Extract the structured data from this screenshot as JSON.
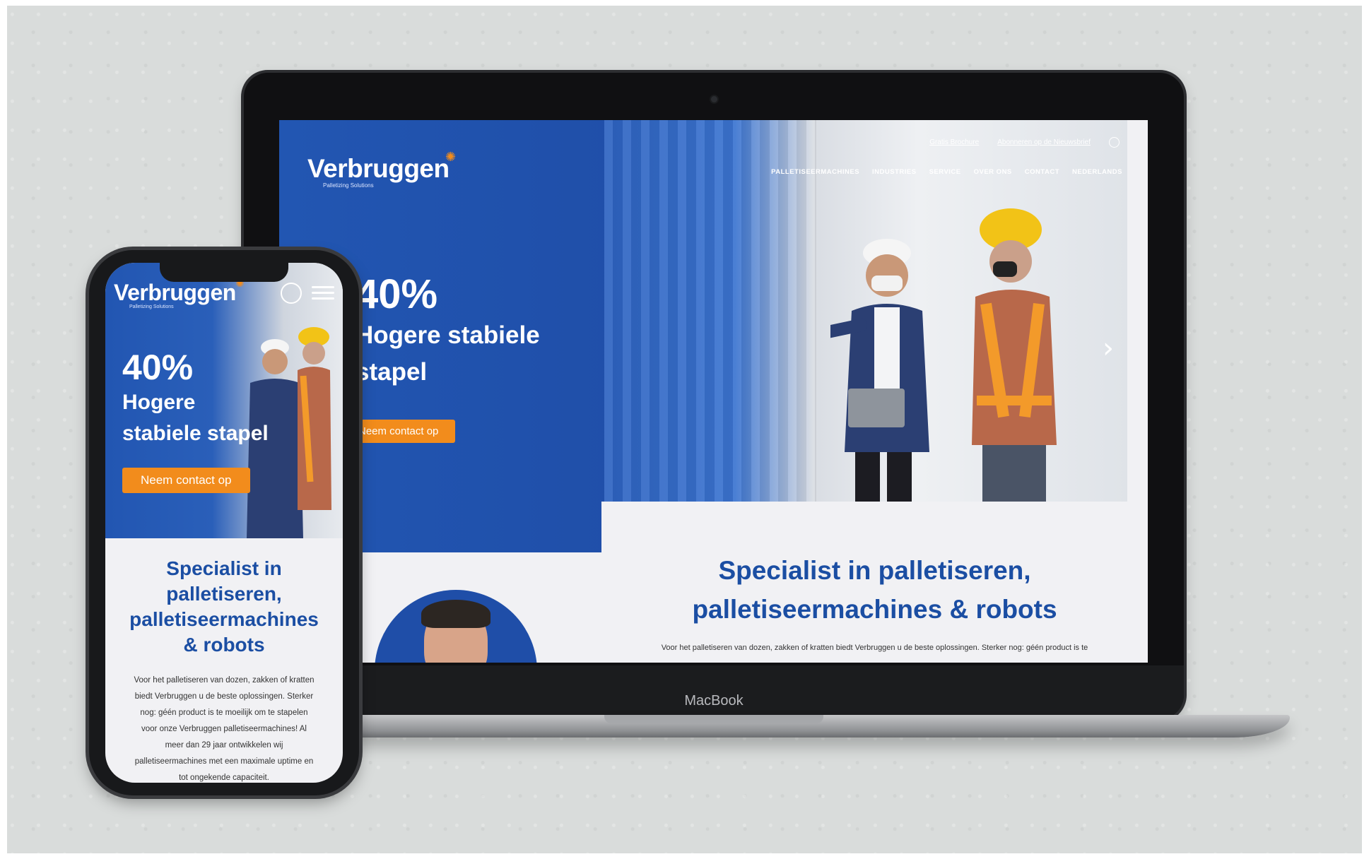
{
  "brand": {
    "name": "Verbruggen",
    "tagline": "Palletizing Solutions",
    "accent_color": "#f28c1c",
    "primary_color": "#1f4ea8"
  },
  "device_label": "MacBook",
  "desktop": {
    "top_links": [
      "Gratis Brochure",
      "Abonneren op de Nieuwsbrief"
    ],
    "nav": [
      "PALLETISEERMACHINES",
      "INDUSTRIES",
      "SERVICE",
      "OVER ONS",
      "CONTACT",
      "NEDERLANDS"
    ],
    "hero": {
      "percent": "40%",
      "subtitle_line1": "Hogere stabiele",
      "subtitle_line2": "stapel",
      "cta": "Neem contact op",
      "next_icon": "chevron-right-icon"
    },
    "section": {
      "heading_line1": "Specialist in palletiseren,",
      "heading_line2": "palletiseermachines & robots",
      "body": "Voor het palletiseren van dozen, zakken of kratten biedt Verbruggen u de beste oplossingen. Sterker nog: géén product is te"
    }
  },
  "mobile": {
    "hero": {
      "percent": "40%",
      "subtitle_line1": "Hogere",
      "subtitle_line2": "stabiele stapel",
      "cta": "Neem contact op"
    },
    "section": {
      "heading_line1": "Specialist in",
      "heading_line2": "palletiseren,",
      "heading_line3": "palletiseermachines",
      "heading_line4": "& robots",
      "body": "Voor het palletiseren van dozen, zakken of kratten biedt Verbruggen u de beste oplossingen. Sterker nog: géén product is te moeilijk om te stapelen voor onze Verbruggen palletiseermachines! Al meer dan 29 jaar ontwikkelen wij palletiseermachines met een maximale uptime en tot ongekende capaciteit."
    }
  }
}
